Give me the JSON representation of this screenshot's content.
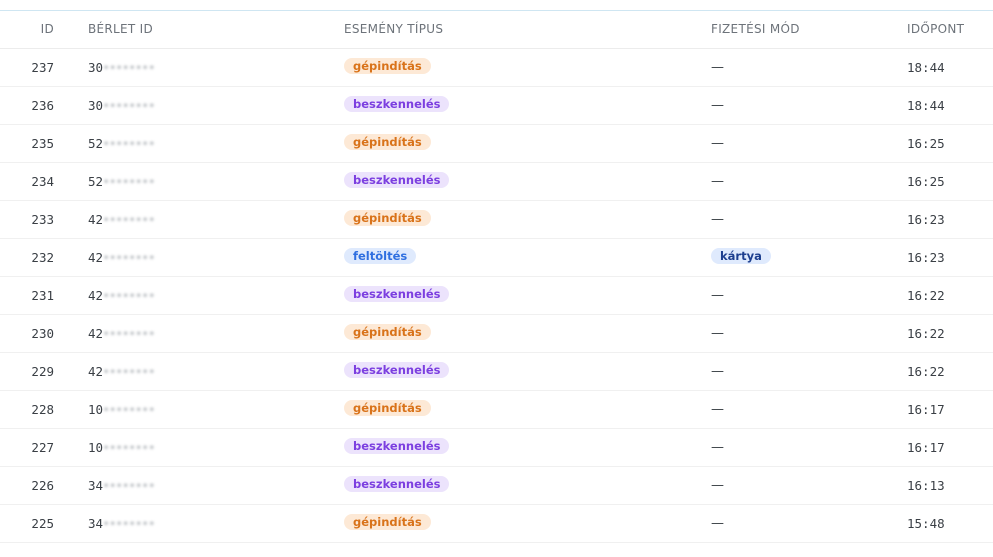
{
  "table": {
    "headers": {
      "id": "ID",
      "berlet_id": "BÉRLET ID",
      "event_type": "ESEMÉNY TÍPUS",
      "payment_method": "FIZETÉSI MÓD",
      "time": "IDŐPONT"
    },
    "rows": [
      {
        "id": "237",
        "berlet_prefix": "30",
        "berlet_masked": "********",
        "event": "gépindítás",
        "event_kind": "start",
        "payment": "—",
        "payment_kind": "none",
        "time": "18:44"
      },
      {
        "id": "236",
        "berlet_prefix": "30",
        "berlet_masked": "********",
        "event": "beszkennelés",
        "event_kind": "scan",
        "payment": "—",
        "payment_kind": "none",
        "time": "18:44"
      },
      {
        "id": "235",
        "berlet_prefix": "52",
        "berlet_masked": "********",
        "event": "gépindítás",
        "event_kind": "start",
        "payment": "—",
        "payment_kind": "none",
        "time": "16:25"
      },
      {
        "id": "234",
        "berlet_prefix": "52",
        "berlet_masked": "********",
        "event": "beszkennelés",
        "event_kind": "scan",
        "payment": "—",
        "payment_kind": "none",
        "time": "16:25"
      },
      {
        "id": "233",
        "berlet_prefix": "42",
        "berlet_masked": "********",
        "event": "gépindítás",
        "event_kind": "start",
        "payment": "—",
        "payment_kind": "none",
        "time": "16:23"
      },
      {
        "id": "232",
        "berlet_prefix": "42",
        "berlet_masked": "********",
        "event": "feltöltés",
        "event_kind": "topup",
        "payment": "kártya",
        "payment_kind": "card",
        "time": "16:23"
      },
      {
        "id": "231",
        "berlet_prefix": "42",
        "berlet_masked": "********",
        "event": "beszkennelés",
        "event_kind": "scan",
        "payment": "—",
        "payment_kind": "none",
        "time": "16:22"
      },
      {
        "id": "230",
        "berlet_prefix": "42",
        "berlet_masked": "********",
        "event": "gépindítás",
        "event_kind": "start",
        "payment": "—",
        "payment_kind": "none",
        "time": "16:22"
      },
      {
        "id": "229",
        "berlet_prefix": "42",
        "berlet_masked": "********",
        "event": "beszkennelés",
        "event_kind": "scan",
        "payment": "—",
        "payment_kind": "none",
        "time": "16:22"
      },
      {
        "id": "228",
        "berlet_prefix": "10",
        "berlet_masked": "********",
        "event": "gépindítás",
        "event_kind": "start",
        "payment": "—",
        "payment_kind": "none",
        "time": "16:17"
      },
      {
        "id": "227",
        "berlet_prefix": "10",
        "berlet_masked": "********",
        "event": "beszkennelés",
        "event_kind": "scan",
        "payment": "—",
        "payment_kind": "none",
        "time": "16:17"
      },
      {
        "id": "226",
        "berlet_prefix": "34",
        "berlet_masked": "********",
        "event": "beszkennelés",
        "event_kind": "scan",
        "payment": "—",
        "payment_kind": "none",
        "time": "16:13"
      },
      {
        "id": "225",
        "berlet_prefix": "34",
        "berlet_masked": "********",
        "event": "gépindítás",
        "event_kind": "start",
        "payment": "—",
        "payment_kind": "none",
        "time": "15:48"
      }
    ]
  },
  "badge_colors": {
    "start": {
      "bg": "#fde9d6",
      "fg": "#d9731a"
    },
    "scan": {
      "bg": "#ece3fc",
      "fg": "#7c3fe0"
    },
    "topup": {
      "bg": "#dfeafd",
      "fg": "#2f6fe0"
    },
    "card": {
      "bg": "#dfeafd",
      "fg": "#1d3f8f"
    }
  }
}
